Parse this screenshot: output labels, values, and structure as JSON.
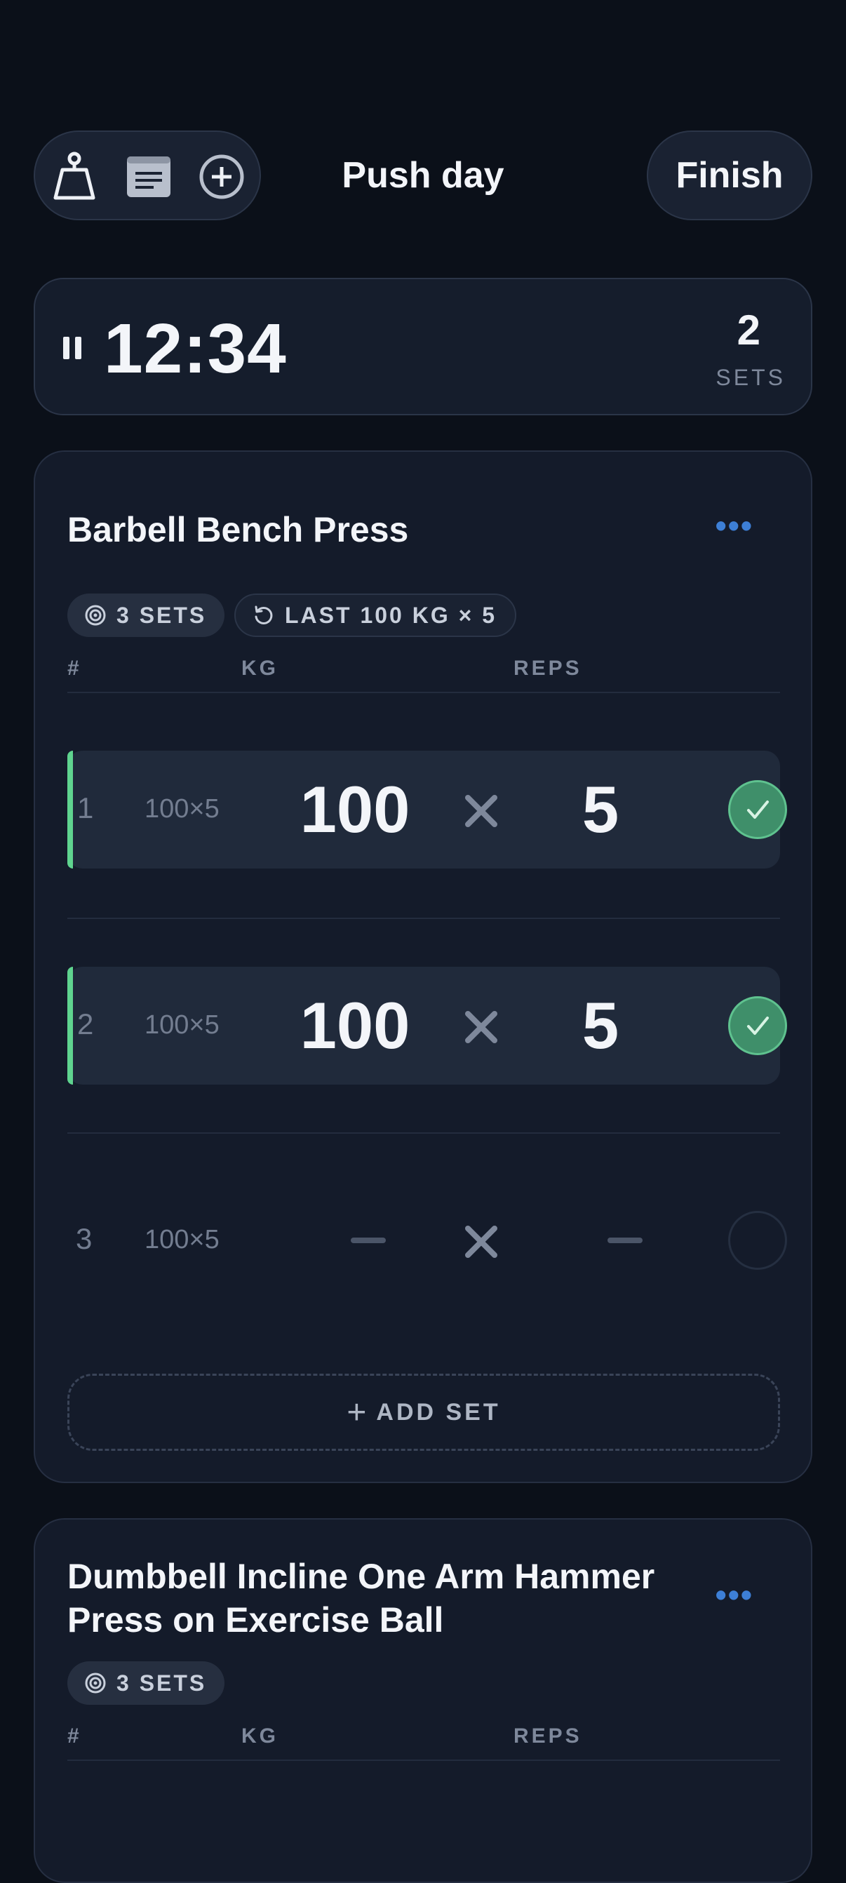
{
  "header": {
    "title": "Push day",
    "finish_label": "Finish",
    "tool_icons": [
      "kettlebell-icon",
      "notes-icon",
      "add-circle-icon"
    ]
  },
  "timer": {
    "time": "12:34",
    "sets_count": "2",
    "sets_label": "SETS",
    "state_icon": "pause-icon"
  },
  "exercises": [
    {
      "name": "Barbell Bench Press",
      "more_label": "•••",
      "chips": {
        "sets": "3 SETS",
        "last": "LAST 100 KG × 5"
      },
      "columns": {
        "num": "#",
        "kg": "KG",
        "reps": "REPS"
      },
      "sets": [
        {
          "num": "1",
          "prev": "100×5",
          "kg": "100",
          "reps": "5",
          "done": true
        },
        {
          "num": "2",
          "prev": "100×5",
          "kg": "100",
          "reps": "5",
          "done": true
        },
        {
          "num": "3",
          "prev": "100×5",
          "kg": "",
          "reps": "",
          "done": false
        }
      ],
      "add_set_label": "ADD SET",
      "add_set_icon": "+"
    },
    {
      "name_line1": "Dumbbell Incline One Arm Hammer",
      "name_line2": "Press on Exercise Ball",
      "more_label": "•••",
      "chips": {
        "sets": "3 SETS"
      },
      "columns": {
        "num": "#",
        "kg": "KG",
        "reps": "REPS"
      }
    }
  ],
  "colors": {
    "accent_blue": "#3d7fd6",
    "done_green": "#5fd48f",
    "background": "#0b1019"
  }
}
